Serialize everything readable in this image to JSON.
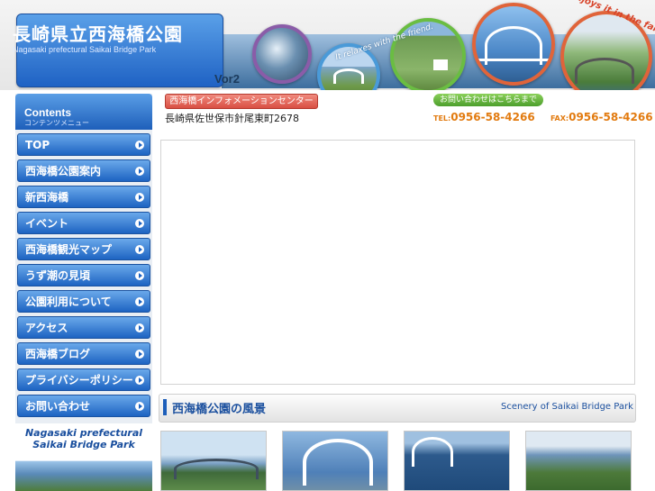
{
  "header": {
    "title": "長崎県立西海橋公園",
    "subtitle": "Nagasaki prefectural Saikai Bridge Park",
    "version": "Vor2",
    "banner_text_1": "It relaxes with the friend.",
    "banner_text_2": "It enjoys it in the family."
  },
  "info": {
    "center_label": "西海橋インフォメーションセンター",
    "address": "長崎県佐世保市針尾東町2678",
    "contact_label": "お問い合わせはこちらまで",
    "tel_prefix": "TEL:",
    "tel": "0956-58-4266",
    "fax_prefix": "FAX:",
    "fax": "0956-58-4266"
  },
  "sidebar": {
    "title": "Contents",
    "subtitle": "コンテンツメニュー",
    "items": [
      {
        "label": "TOP"
      },
      {
        "label": "西海橋公園案内"
      },
      {
        "label": "新西海橋"
      },
      {
        "label": "イベント"
      },
      {
        "label": "西海橋観光マップ"
      },
      {
        "label": "うず潮の見頃"
      },
      {
        "label": "公園利用について"
      },
      {
        "label": "アクセス"
      },
      {
        "label": "西海橋ブログ"
      },
      {
        "label": "プライバシーポリシー"
      },
      {
        "label": "お問い合わせ"
      }
    ],
    "banner_line1": "Nagasaki prefectural",
    "banner_line2": "Saikai Bridge Park"
  },
  "scenery": {
    "title": "西海橋公園の風景",
    "subtitle": "Scenery of Saikai Bridge Park"
  }
}
